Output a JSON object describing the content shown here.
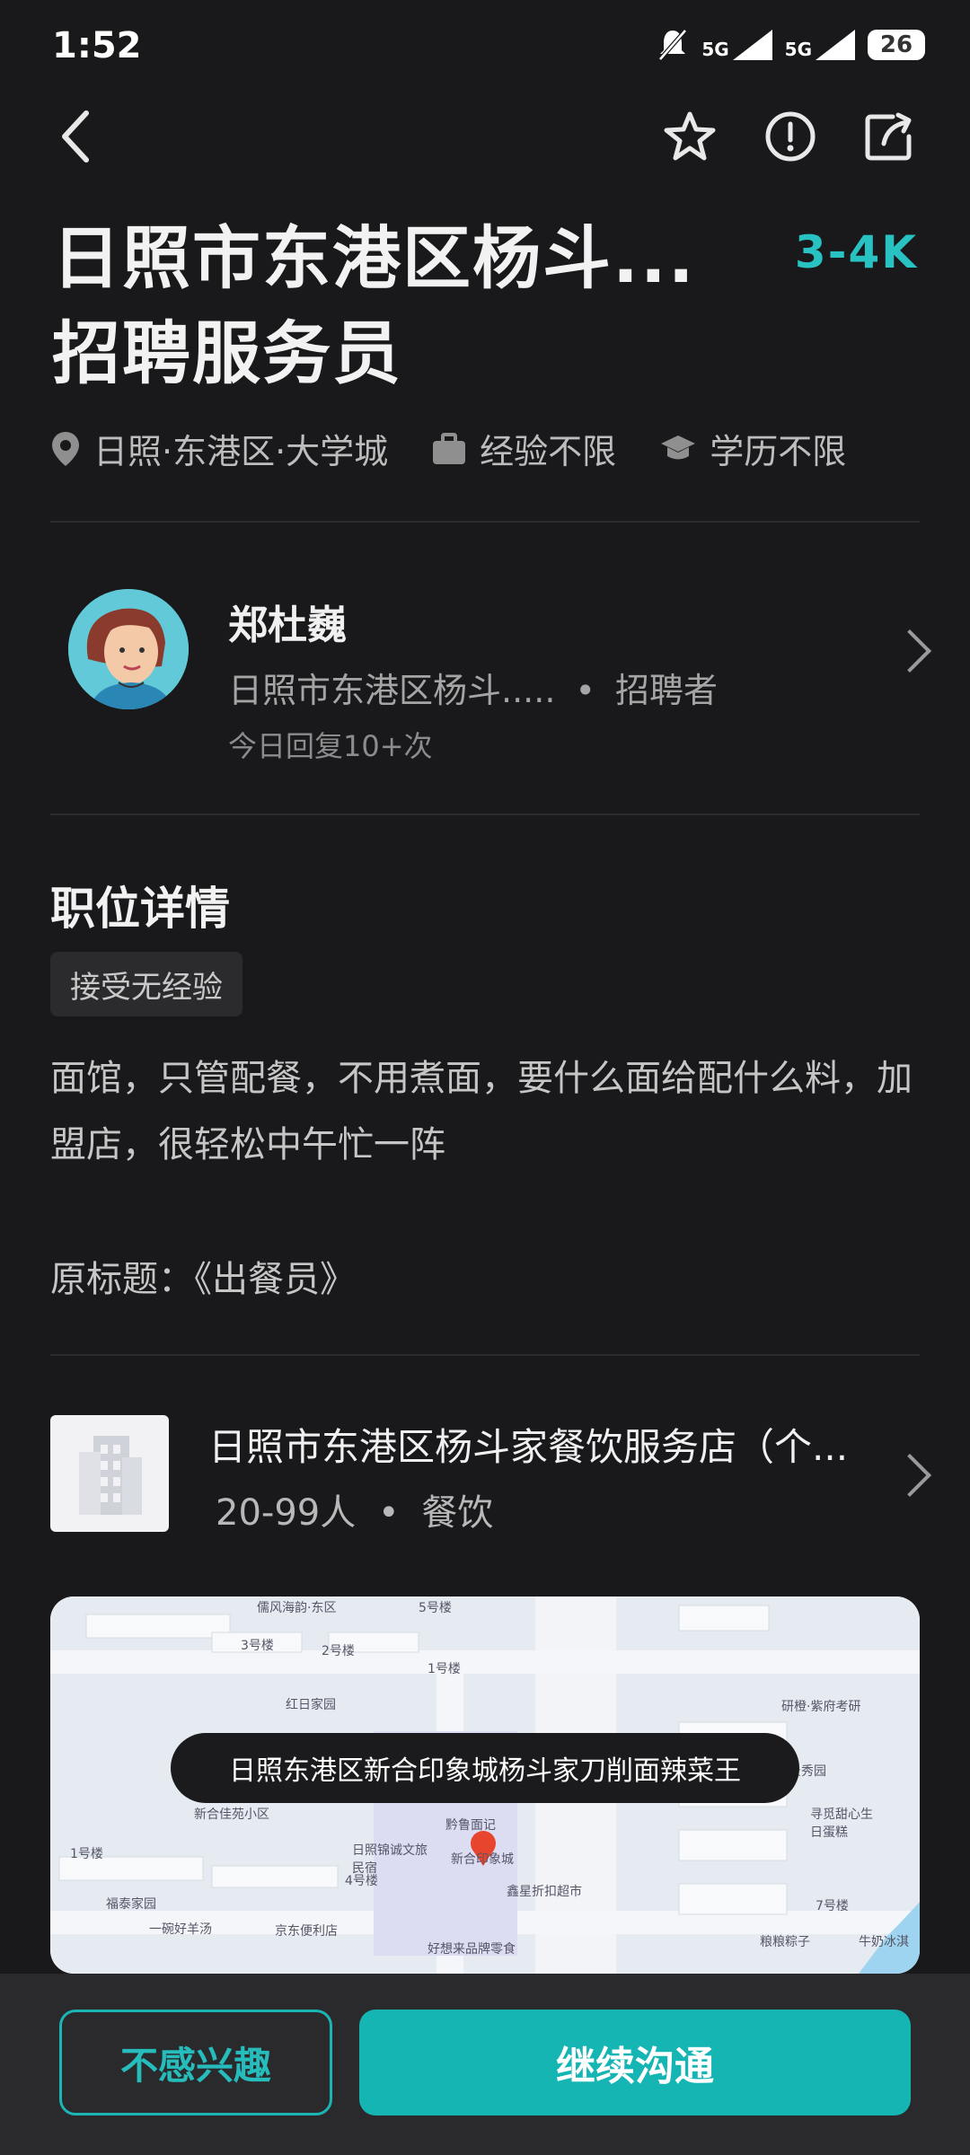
{
  "status_bar": {
    "time": "1:52",
    "signal1": "5G",
    "signal2": "5G",
    "battery": "26"
  },
  "header": {
    "back_icon": "back-arrow-icon",
    "actions": [
      "star-icon",
      "report-warning-icon",
      "share-icon"
    ]
  },
  "job": {
    "title": "日照市东港区杨斗...招聘服务员",
    "salary": "3-4K",
    "location": "日照·东港区·大学城",
    "experience": "经验不限",
    "education": "学历不限"
  },
  "recruiter": {
    "name": "郑杜巍",
    "company_short": "日照市东港区杨斗.....",
    "dot": "•",
    "role": "招聘者",
    "reply": "今日回复10+次"
  },
  "details": {
    "section_title": "职位详情",
    "tag": "接受无经验",
    "description": "面馆，只管配餐，不用煮面，要什么面给配什么料，加盟店，很轻松中午忙一阵",
    "original_title": "原标题：《出餐员》"
  },
  "company": {
    "name": "日照市东港区杨斗家餐饮服务店（个...",
    "size": "20-99人",
    "dot": "•",
    "industry": "餐饮"
  },
  "map": {
    "bubble": "日照东港区新合印象城杨斗家刀削面辣菜王",
    "labels": [
      "儒风海韵·东区",
      "5号楼",
      "3号楼",
      "2号楼",
      "1号楼",
      "红日家园",
      "新合佳苑小区",
      "日照锦诚文旅民宿",
      "新合印象城",
      "黔鲁面记",
      "鑫星折扣超市",
      "4号楼",
      "福泰家园",
      "一碗好羊汤",
      "京东便利店",
      "好想来品牌零食",
      "1号楼",
      "研橙·紫府考研",
      "景秀园",
      "寻觅甜心生日蛋糕",
      "7号楼",
      "粮粮粽子",
      "牛奶冰淇"
    ]
  },
  "actions": {
    "not_interested": "不感兴趣",
    "continue_chat": "继续沟通"
  }
}
